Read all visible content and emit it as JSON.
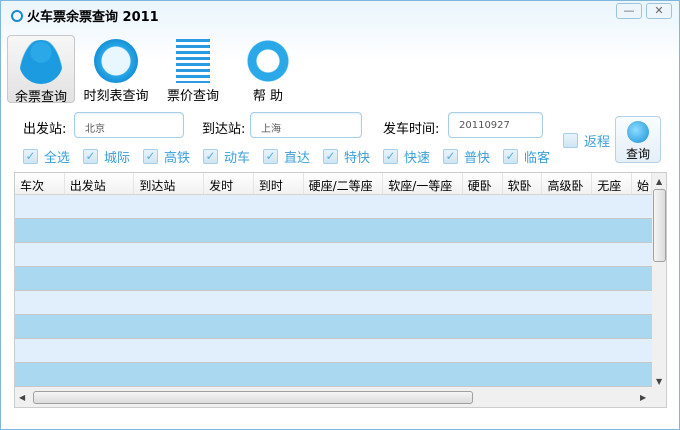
{
  "window": {
    "title": "火车票余票查询 2011",
    "minimize": "—",
    "close": "✕"
  },
  "toolbar": [
    {
      "label": "余票查询",
      "icon": "user-search-icon",
      "active": true
    },
    {
      "label": "时刻表查询",
      "icon": "clock-icon"
    },
    {
      "label": "票价查询",
      "icon": "list-icon"
    },
    {
      "label": "帮  助",
      "icon": "lifebuoy-icon"
    }
  ],
  "form": {
    "from_label": "出发站:",
    "from_value": "北京",
    "to_label": "到达站:",
    "to_value": "上海",
    "date_label": "发车时间:",
    "date_value": "20110927",
    "return_label": "返程",
    "return_checked": false,
    "query_label": "查询"
  },
  "filters": [
    {
      "label": "全选",
      "checked": true
    },
    {
      "label": "城际",
      "checked": true
    },
    {
      "label": "高铁",
      "checked": true
    },
    {
      "label": "动车",
      "checked": true
    },
    {
      "label": "直达",
      "checked": true
    },
    {
      "label": "特快",
      "checked": true
    },
    {
      "label": "快速",
      "checked": true
    },
    {
      "label": "普快",
      "checked": true
    },
    {
      "label": "临客",
      "checked": true
    }
  ],
  "table": {
    "columns": [
      "车次",
      "出发站",
      "到达站",
      "发时",
      "到时",
      "硬座/二等座",
      "软座/一等座",
      "硬卧",
      "软卧",
      "高级卧",
      "无座",
      "始"
    ],
    "rows": [],
    "row_colors": [
      "#e1eefb",
      "#a9d8f0"
    ]
  }
}
